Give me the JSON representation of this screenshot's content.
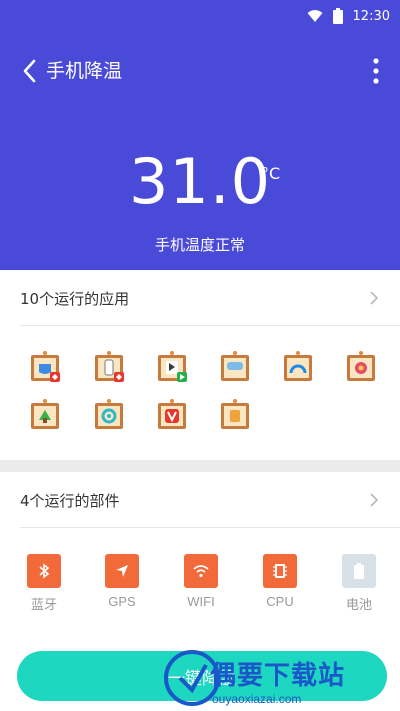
{
  "status_bar": {
    "time": "12:30"
  },
  "header": {
    "title": "手机降温"
  },
  "temperature": {
    "value": "31.0",
    "unit": "°C",
    "status": "手机温度正常"
  },
  "apps_section": {
    "label": "10个运行的应用",
    "apps": [
      {
        "icon": "mug-app-icon"
      },
      {
        "icon": "phone-app-icon"
      },
      {
        "icon": "play-app-icon"
      },
      {
        "icon": "cloud-app-icon"
      },
      {
        "icon": "dial-app-icon"
      },
      {
        "icon": "flower-app-icon"
      },
      {
        "icon": "leaf-app-icon"
      },
      {
        "icon": "swirl-app-icon"
      },
      {
        "icon": "v-app-icon"
      },
      {
        "icon": "bag-app-icon"
      }
    ]
  },
  "parts_section": {
    "label": "4个运行的部件",
    "parts": [
      {
        "label": "蓝牙",
        "icon": "bluetooth-icon",
        "color": "#f26a3a"
      },
      {
        "label": "GPS",
        "icon": "gps-icon",
        "color": "#f26a3a"
      },
      {
        "label": "WIFI",
        "icon": "wifi-icon",
        "color": "#f26a3a"
      },
      {
        "label": "CPU",
        "icon": "cpu-icon",
        "color": "#f26a3a"
      },
      {
        "label": "电池",
        "icon": "battery-icon",
        "color": "#d8e0e8"
      }
    ]
  },
  "action": {
    "label": "一键降温"
  },
  "watermark": {
    "text": "偶要下载站",
    "url": "ouyaoxiazai.com"
  },
  "colors": {
    "primary": "#4a4ad8",
    "accent": "#1dd7c0",
    "part": "#f26a3a"
  }
}
